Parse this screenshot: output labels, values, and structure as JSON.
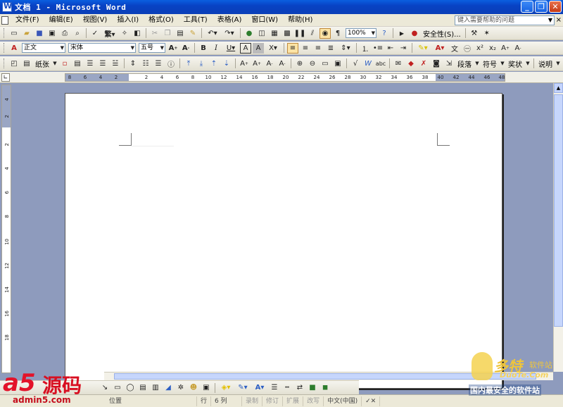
{
  "window": {
    "title": "文档 1 - Microsoft Word",
    "min": "_",
    "max": "❐",
    "close": "✕"
  },
  "menu": {
    "items": [
      "文件(F)",
      "编辑(E)",
      "视图(V)",
      "插入(I)",
      "格式(O)",
      "工具(T)",
      "表格(A)",
      "窗口(W)",
      "帮助(H)"
    ],
    "help_placeholder": "键入需要帮助的问题",
    "close": "×"
  },
  "standard_toolbar": {
    "zoom": "100%",
    "security_label": "安全性(S)..."
  },
  "format_toolbar": {
    "style": "正文",
    "font": "宋体",
    "size": "五号"
  },
  "extra_toolbar": {
    "paper_label": "纸张",
    "paragraph_label": "段落",
    "symbol_label": "符号",
    "award_label": "奖状",
    "explain_label": "说明"
  },
  "hruler": {
    "ticks": [
      "8",
      "6",
      "4",
      "2",
      "2",
      "4",
      "6",
      "8",
      "10",
      "12",
      "14",
      "16",
      "18",
      "20",
      "22",
      "24",
      "26",
      "28",
      "30",
      "32",
      "34",
      "36",
      "38",
      "40",
      "42",
      "44",
      "46",
      "48"
    ]
  },
  "vruler": {
    "ticks": [
      "4",
      "2",
      "2",
      "4",
      "6",
      "8",
      "10",
      "12",
      "14",
      "16",
      "18"
    ]
  },
  "statusbar": {
    "position_label": "位置",
    "line_label": "行",
    "col_label": "6 列",
    "rec": "录制",
    "trk": "修订",
    "ext": "扩展",
    "ovr": "改写",
    "lang": "中文(中国)"
  },
  "watermark_left": {
    "brand": "a5",
    "brand_cn": "源码",
    "url": "admin5.com"
  },
  "watermark_right": {
    "brand_cn": "多特",
    "suffix": "软件站",
    "url": "DuoTe.Com",
    "slogan": "国内最安全的软件站"
  }
}
